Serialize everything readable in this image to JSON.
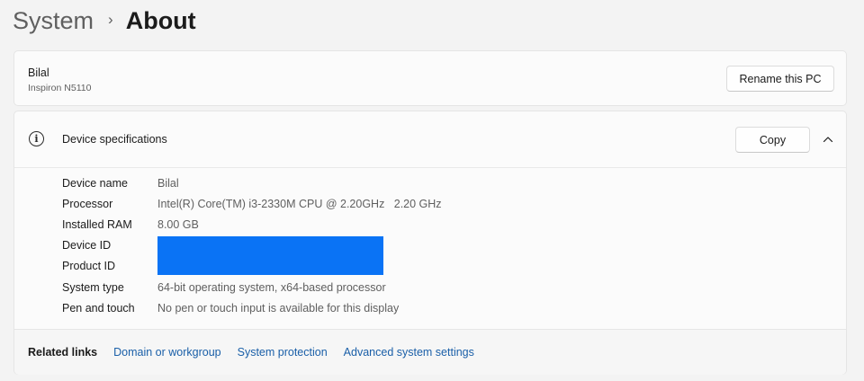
{
  "breadcrumb": {
    "parent": "System",
    "separator": "›",
    "current": "About"
  },
  "pc": {
    "name": "Bilal",
    "model": "Inspiron N5110",
    "rename_label": "Rename this PC"
  },
  "device_specs": {
    "title": "Device specifications",
    "copy_label": "Copy",
    "icon": "info-icon",
    "expanded": true,
    "rows": [
      {
        "label": "Device name",
        "value": "Bilal"
      },
      {
        "label": "Processor",
        "value": "Intel(R) Core(TM) i3-2330M CPU @ 2.20GHz   2.20 GHz"
      },
      {
        "label": "Installed RAM",
        "value": "8.00 GB"
      },
      {
        "label": "Device ID",
        "value": ""
      },
      {
        "label": "Product ID",
        "value": ""
      },
      {
        "label": "System type",
        "value": "64-bit operating system, x64-based processor"
      },
      {
        "label": "Pen and touch",
        "value": "No pen or touch input is available for this display"
      }
    ]
  },
  "related_links": {
    "label": "Related links",
    "links": [
      "Domain or workgroup",
      "System protection",
      "Advanced system settings"
    ]
  },
  "colors": {
    "redaction": "#0a73f5",
    "link": "#1a5fa8",
    "background": "#f3f3f3"
  }
}
